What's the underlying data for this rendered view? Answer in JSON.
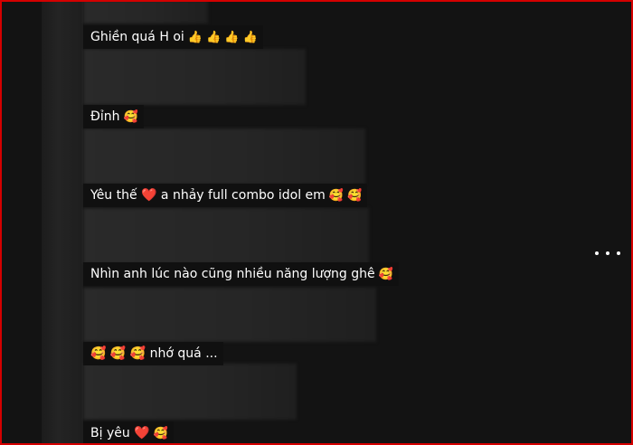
{
  "comments": [
    {
      "text": "Ghiền quá H oi",
      "emojis": "👍 👍 👍 👍"
    },
    {
      "text": "Đỉnh",
      "emojis": "🥰"
    },
    {
      "text": "Yêu thế ❤️ a nhảy full combo idol em",
      "emojis": "🥰 🥰"
    },
    {
      "text": "Nhìn anh lúc nào cũng nhiều năng lượng ghê",
      "emojis": "🥰"
    },
    {
      "text": "🥰 🥰 🥰 nhớ quá ...",
      "emojis": ""
    },
    {
      "text": "Bị yêu ❤️",
      "emojis": "🥰"
    }
  ],
  "icons": {
    "more": "more-options-icon"
  },
  "colors": {
    "background": "#131313",
    "comment_bg": "#101010",
    "text": "#ffffff",
    "frame": "#d40000"
  }
}
